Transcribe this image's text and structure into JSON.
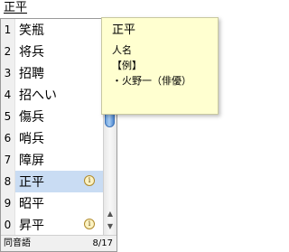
{
  "composition_text": "正平",
  "candidates": [
    {
      "num": "1",
      "word": "笑瓶",
      "info": false
    },
    {
      "num": "2",
      "word": "将兵",
      "info": false
    },
    {
      "num": "3",
      "word": "招聘",
      "info": false
    },
    {
      "num": "4",
      "word": "招へい",
      "info": false
    },
    {
      "num": "5",
      "word": "傷兵",
      "info": false
    },
    {
      "num": "6",
      "word": "哨兵",
      "info": false
    },
    {
      "num": "7",
      "word": "障屏",
      "info": false
    },
    {
      "num": "8",
      "word": "正平",
      "info": true,
      "selected": true
    },
    {
      "num": "9",
      "word": "昭平",
      "info": false
    },
    {
      "num": "0",
      "word": "昇平",
      "info": true
    }
  ],
  "info_icon_glyph": "i",
  "scroll": {
    "up_arrow": "▲",
    "down_arrow": "▼"
  },
  "footer": {
    "category": "同音語",
    "counter": "8/17"
  },
  "annotation": {
    "title": "正平",
    "lines": [
      "人名",
      "【例】",
      "・火野一（俳優）"
    ]
  },
  "colors": {
    "selection": "#c9dcf3",
    "annotation_bg": "#ffffd0",
    "scroll_thumb": "#6fa3dd"
  }
}
